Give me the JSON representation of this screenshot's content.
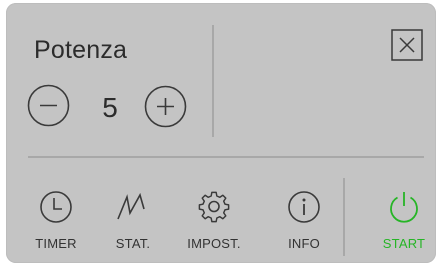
{
  "theme": {
    "panel_color": "#c4c4c4",
    "text_color": "#2c2c2c",
    "icon_color": "#3a3a3a",
    "accent_start": "#26b526"
  },
  "power": {
    "label": "Potenza",
    "value": "5",
    "decrease_icon": "minus-circle-icon",
    "increase_icon": "plus-circle-icon"
  },
  "dialog": {
    "close_icon": "close-square-icon"
  },
  "nav": [
    {
      "id": "timer",
      "label": "TIMER",
      "icon": "clock-icon"
    },
    {
      "id": "stat",
      "label": "STAT.",
      "icon": "zigzag-chart-icon"
    },
    {
      "id": "impost",
      "label": "IMPOST.",
      "icon": "gear-icon"
    },
    {
      "id": "info",
      "label": "INFO",
      "icon": "info-circle-icon"
    },
    {
      "id": "start",
      "label": "START",
      "icon": "power-icon"
    }
  ]
}
